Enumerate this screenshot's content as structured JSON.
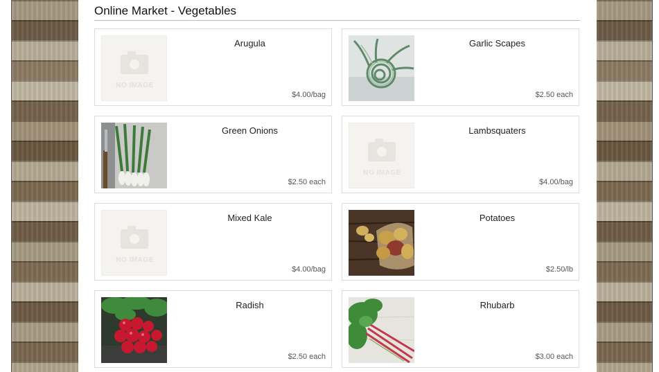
{
  "page": {
    "title": "Online Market - Vegetables"
  },
  "no_image_label": "NO IMAGE",
  "products": [
    {
      "name": "Arugula",
      "price": "$4.00/bag",
      "image": "no-image-placeholder"
    },
    {
      "name": "Garlic Scapes",
      "price": "$2.50 each",
      "image": "garlic-scapes-photo"
    },
    {
      "name": "Green Onions",
      "price": "$2.50 each",
      "image": "green-onions-photo"
    },
    {
      "name": "Lambsquaters",
      "price": "$4.00/bag",
      "image": "no-image-placeholder"
    },
    {
      "name": "Mixed Kale",
      "price": "$4.00/bag",
      "image": "no-image-placeholder"
    },
    {
      "name": "Potatoes",
      "price": "$2.50/lb",
      "image": "potatoes-photo"
    },
    {
      "name": "Radish",
      "price": "$2.50 each",
      "image": "radish-photo"
    },
    {
      "name": "Rhubarb",
      "price": "$3.00 each",
      "image": "rhubarb-photo"
    }
  ]
}
